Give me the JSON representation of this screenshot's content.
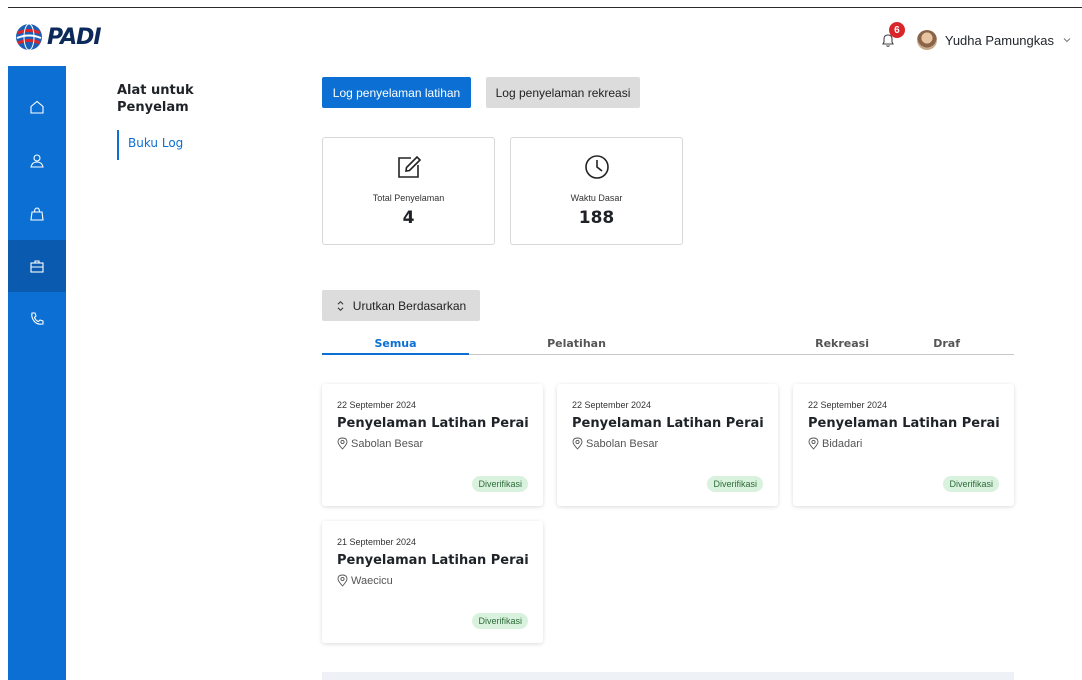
{
  "app": {
    "logo_text": "PADI"
  },
  "header": {
    "notification_count": "6",
    "user_name": "Yudha Pamungkas"
  },
  "sidebar": {
    "icons": [
      "home-icon",
      "user-icon",
      "bag-icon",
      "briefcase-icon",
      "phone-icon"
    ],
    "active_index": 3
  },
  "leftnav": {
    "title": "Alat untuk Penyelam",
    "items": [
      {
        "label": "Buku Log"
      }
    ]
  },
  "actions": {
    "training_log": "Log penyelaman latihan",
    "recreation_log": "Log penyelaman rekreasi",
    "sort": "Urutkan Berdasarkan"
  },
  "stats": [
    {
      "label": "Total Penyelaman",
      "value": "4",
      "icon": "edit-icon"
    },
    {
      "label": "Waktu Dasar",
      "value": "188",
      "icon": "clock-icon"
    }
  ],
  "tabs": [
    "Semua",
    "Pelatihan",
    "Rekreasi",
    "Draf"
  ],
  "active_tab": "Semua",
  "dives": [
    {
      "date": "22 September 2024",
      "title": "Penyelaman Latihan Perairan...",
      "location": "Sabolan Besar",
      "status": "Diverifikasi"
    },
    {
      "date": "22 September 2024",
      "title": "Penyelaman Latihan Perairan...",
      "location": "Sabolan Besar",
      "status": "Diverifikasi"
    },
    {
      "date": "22 September 2024",
      "title": "Penyelaman Latihan Perairan...",
      "location": "Bidadari",
      "status": "Diverifikasi"
    },
    {
      "date": "21 September 2024",
      "title": "Penyelaman Latihan Perairan...",
      "location": "Waecicu",
      "status": "Diverifikasi"
    }
  ],
  "colors": {
    "primary": "#0b6fd3",
    "sidebar": "#0b6fd3",
    "verified_bg": "#d9f2dd",
    "badge": "#d9262b"
  }
}
